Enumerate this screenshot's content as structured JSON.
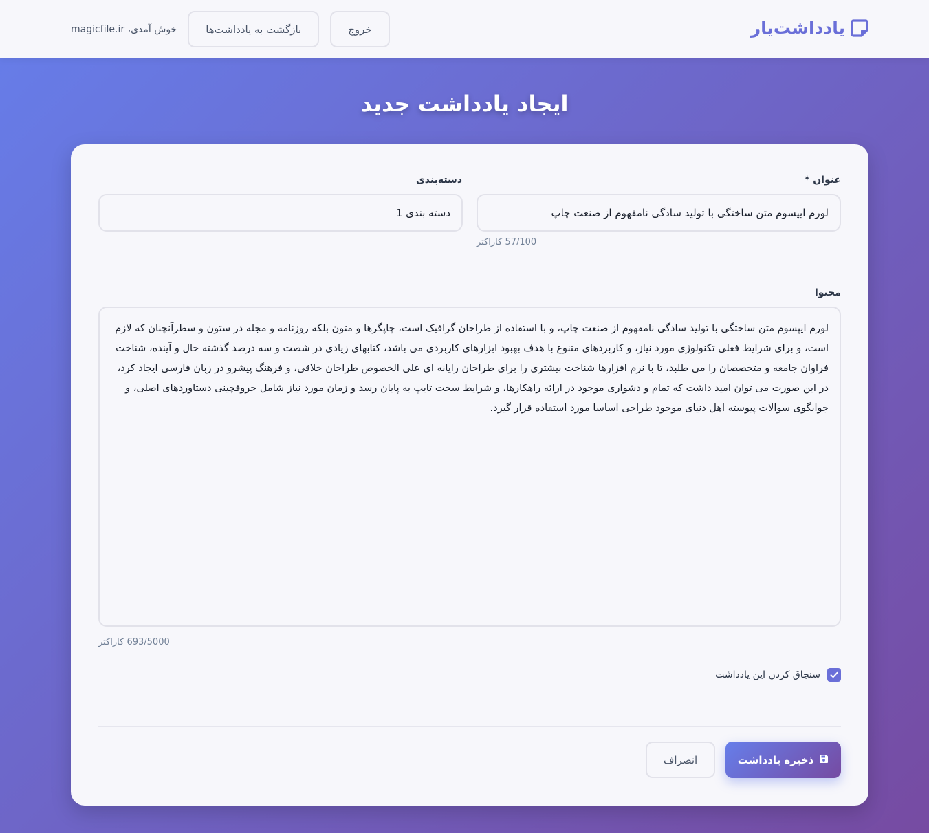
{
  "header": {
    "brand": "یادداشت‌یار",
    "welcome": "خوش آمدی، magicfile.ir",
    "back_button": "بازگشت به یادداشت‌ها",
    "logout_button": "خروج"
  },
  "page": {
    "title": "ایجاد یادداشت جدید"
  },
  "form": {
    "title_label": "عنوان *",
    "title_value": "لورم ایپسوم متن ساختگی با تولید سادگی نامفهوم از صنعت چاپ",
    "title_counter": "57/100 کاراکتر",
    "category_label": "دسته‌بندی",
    "category_value": "دسته بندی 1",
    "content_label": "محتوا",
    "content_value": "لورم ایپسوم متن ساختگی با تولید سادگی نامفهوم از صنعت چاپ، و با استفاده از طراحان گرافیک است، چاپگرها و متون بلکه روزنامه و مجله در ستون و سطرآنچنان که لازم است، و برای شرایط فعلی تکنولوژی مورد نیاز، و کاربردهای متنوع با هدف بهبود ابزارهای کاربردی می باشد، کتابهای زیادی در شصت و سه درصد گذشته حال و آینده، شناخت فراوان جامعه و متخصصان را می طلبد، تا با نرم افزارها شناخت بیشتری را برای طراحان رایانه ای علی الخصوص طراحان خلاقی، و فرهنگ پیشرو در زبان فارسی ایجاد کرد، در این صورت می توان امید داشت که تمام و دشواری موجود در ارائه راهکارها، و شرایط سخت تایپ به پایان رسد و زمان مورد نیاز شامل حروفچینی دستاوردهای اصلی، و جوابگوی سوالات پیوسته اهل دنیای موجود طراحی اساسا مورد استفاده قرار گیرد.",
    "content_counter": "693/5000 کاراکتر",
    "pin_label": "سنجاق کردن این یادداشت",
    "pin_checked": true,
    "save_button": "ذخیره یادداشت",
    "cancel_button": "انصراف"
  },
  "colors": {
    "accent": "#6a6fd8",
    "gradient_start": "#667eea",
    "gradient_end": "#764ba2"
  }
}
